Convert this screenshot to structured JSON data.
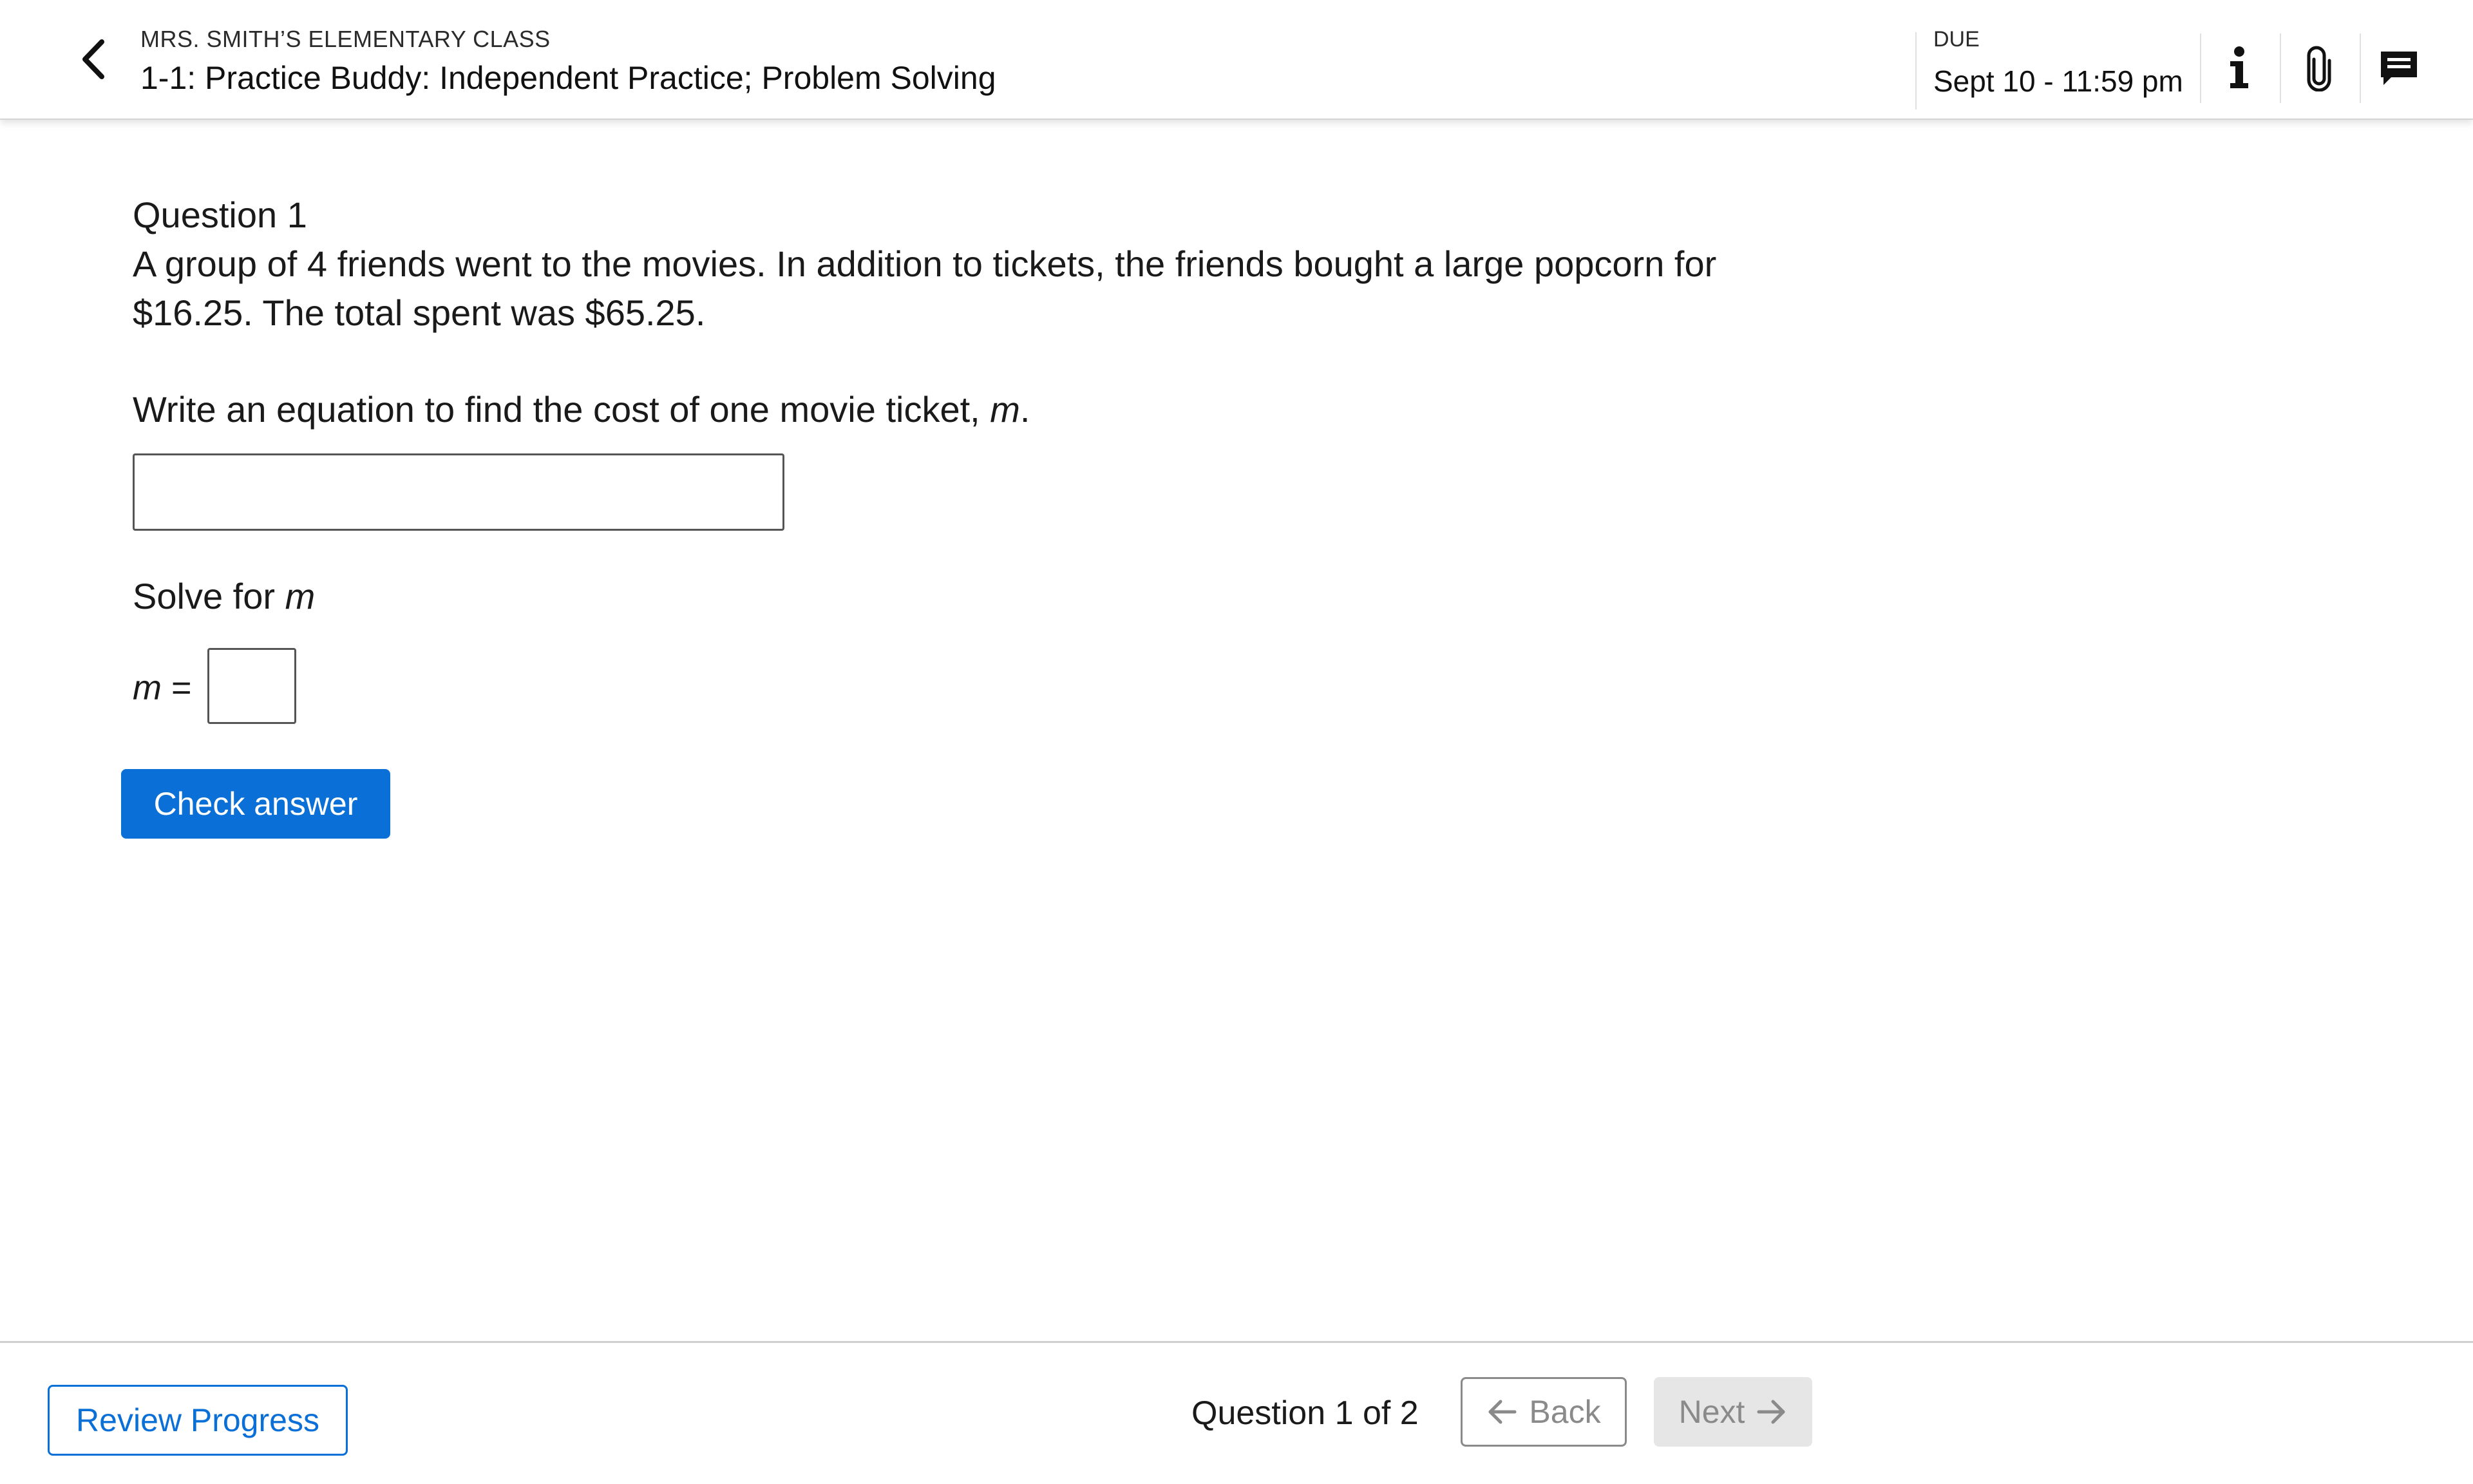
{
  "header": {
    "class_name": "MRS. SMITH’S ELEMENTARY CLASS",
    "assignment_title": "1-1: Practice Buddy: Independent Practice; Problem Solving",
    "due_label": "DUE",
    "due_date": "Sept 10 - 11:59 pm",
    "icons": [
      "back-chevron-icon",
      "info-icon",
      "attachment-icon",
      "comment-icon"
    ]
  },
  "question": {
    "number_label": "Question 1",
    "text": "A group of 4 friends went to the movies. In addition to tickets, the friends bought a large popcorn for $16.25. The total spent was $65.25.",
    "prompt_text": "Write an equation to find the cost of one movie ticket, ",
    "prompt_variable": "m",
    "prompt_end": ".",
    "equation_input_value": "",
    "solve_text": "Solve for ",
    "solve_variable": "m",
    "m_variable": "m",
    "m_equals": " =",
    "m_input_value": "",
    "check_button_label": "Check answer"
  },
  "footer": {
    "review_button_label": "Review Progress",
    "question_counter": "Question 1 of 2",
    "back_label": "Back",
    "next_label": "Next"
  },
  "colors": {
    "accent": "#0a6fd6",
    "disabled_text": "#8a8a8a",
    "disabled_bg": "#e6e6e6"
  }
}
